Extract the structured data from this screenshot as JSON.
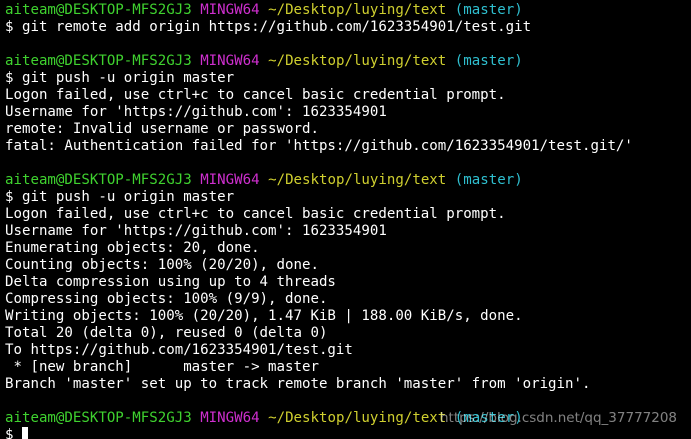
{
  "terminal": {
    "colors": {
      "background": "#000000",
      "text": "#ffffff",
      "user_host": "#3fd22f",
      "msys": "#cf2fcf",
      "path": "#cfcf2f",
      "branch": "#2fbfcf"
    },
    "lines": [
      [
        {
          "c": "user_host",
          "t": "aiteam@DESKTOP-MFS2GJ3"
        },
        {
          "c": "text",
          "t": " "
        },
        {
          "c": "msys",
          "t": "MINGW64"
        },
        {
          "c": "text",
          "t": " "
        },
        {
          "c": "path",
          "t": "~/Desktop/luying/text"
        },
        {
          "c": "text",
          "t": " "
        },
        {
          "c": "branch",
          "t": "(master)"
        }
      ],
      [
        {
          "c": "text",
          "t": "$ git remote add origin https://github.com/1623354901/test.git"
        }
      ],
      [
        {
          "c": "text",
          "t": ""
        }
      ],
      [
        {
          "c": "user_host",
          "t": "aiteam@DESKTOP-MFS2GJ3"
        },
        {
          "c": "text",
          "t": " "
        },
        {
          "c": "msys",
          "t": "MINGW64"
        },
        {
          "c": "text",
          "t": " "
        },
        {
          "c": "path",
          "t": "~/Desktop/luying/text"
        },
        {
          "c": "text",
          "t": " "
        },
        {
          "c": "branch",
          "t": "(master)"
        }
      ],
      [
        {
          "c": "text",
          "t": "$ git push -u origin master"
        }
      ],
      [
        {
          "c": "text",
          "t": "Logon failed, use ctrl+c to cancel basic credential prompt."
        }
      ],
      [
        {
          "c": "text",
          "t": "Username for 'https://github.com': 1623354901"
        }
      ],
      [
        {
          "c": "text",
          "t": "remote: Invalid username or password."
        }
      ],
      [
        {
          "c": "text",
          "t": "fatal: Authentication failed for 'https://github.com/1623354901/test.git/'"
        }
      ],
      [
        {
          "c": "text",
          "t": ""
        }
      ],
      [
        {
          "c": "user_host",
          "t": "aiteam@DESKTOP-MFS2GJ3"
        },
        {
          "c": "text",
          "t": " "
        },
        {
          "c": "msys",
          "t": "MINGW64"
        },
        {
          "c": "text",
          "t": " "
        },
        {
          "c": "path",
          "t": "~/Desktop/luying/text"
        },
        {
          "c": "text",
          "t": " "
        },
        {
          "c": "branch",
          "t": "(master)"
        }
      ],
      [
        {
          "c": "text",
          "t": "$ git push -u origin master"
        }
      ],
      [
        {
          "c": "text",
          "t": "Logon failed, use ctrl+c to cancel basic credential prompt."
        }
      ],
      [
        {
          "c": "text",
          "t": "Username for 'https://github.com': 1623354901"
        }
      ],
      [
        {
          "c": "text",
          "t": "Enumerating objects: 20, done."
        }
      ],
      [
        {
          "c": "text",
          "t": "Counting objects: 100% (20/20), done."
        }
      ],
      [
        {
          "c": "text",
          "t": "Delta compression using up to 4 threads"
        }
      ],
      [
        {
          "c": "text",
          "t": "Compressing objects: 100% (9/9), done."
        }
      ],
      [
        {
          "c": "text",
          "t": "Writing objects: 100% (20/20), 1.47 KiB | 188.00 KiB/s, done."
        }
      ],
      [
        {
          "c": "text",
          "t": "Total 20 (delta 0), reused 0 (delta 0)"
        }
      ],
      [
        {
          "c": "text",
          "t": "To https://github.com/1623354901/test.git"
        }
      ],
      [
        {
          "c": "text",
          "t": " * [new branch]      master -> master"
        }
      ],
      [
        {
          "c": "text",
          "t": "Branch 'master' set up to track remote branch 'master' from 'origin'."
        }
      ],
      [
        {
          "c": "text",
          "t": ""
        }
      ],
      [
        {
          "c": "user_host",
          "t": "aiteam@DESKTOP-MFS2GJ3"
        },
        {
          "c": "text",
          "t": " "
        },
        {
          "c": "msys",
          "t": "MINGW64"
        },
        {
          "c": "text",
          "t": " "
        },
        {
          "c": "path",
          "t": "~/Desktop/luying/text"
        },
        {
          "c": "text",
          "t": " "
        },
        {
          "c": "branch",
          "t": "(master)"
        }
      ],
      [
        {
          "c": "text",
          "t": "$ "
        }
      ]
    ]
  },
  "watermark": {
    "text": "https://blog.csdn.net/qq_37777208"
  }
}
